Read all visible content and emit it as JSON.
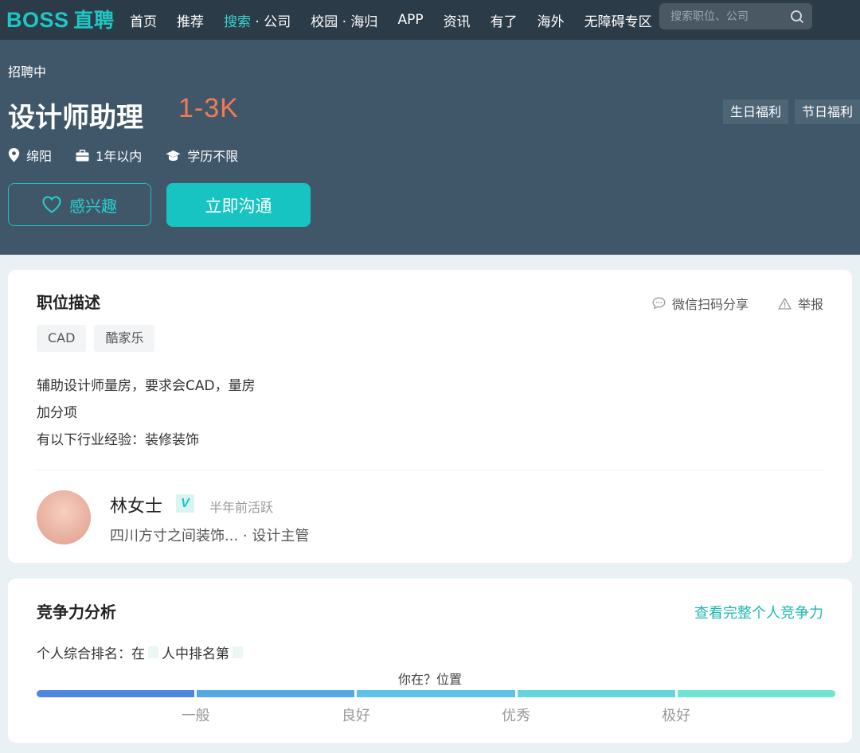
{
  "nav": {
    "logo_en": "BOSS",
    "logo_zh": "直聘",
    "items": [
      {
        "label": "首页"
      },
      {
        "label": "推荐"
      },
      {
        "label": "搜索",
        "sub": " · 公司"
      },
      {
        "label": "校园 · 海归"
      },
      {
        "label": "APP"
      },
      {
        "label": "资讯"
      },
      {
        "label": "有了"
      },
      {
        "label": "海外"
      },
      {
        "label": "无障碍专区"
      }
    ],
    "search_placeholder": "搜索职位、公司"
  },
  "job": {
    "status": "招聘中",
    "title": "设计师助理",
    "salary": "1-3K",
    "benefits": [
      "生日福利",
      "节日福利"
    ],
    "location": "绵阳",
    "experience": "1年以内",
    "education": "学历不限",
    "interest_label": "感兴趣",
    "chat_label": "立即沟通"
  },
  "description": {
    "title": "职位描述",
    "share_label": "微信扫码分享",
    "report_label": "举报",
    "skills": [
      "CAD",
      "酷家乐"
    ],
    "lines": [
      "辅助设计师量房，要求会CAD，量房",
      "加分项",
      "有以下行业经验：装修装饰"
    ]
  },
  "recruiter": {
    "name": "林女士",
    "verified_mark": "V",
    "active": "半年前活跃",
    "company_role": "四川方寸之间装饰...  ·  设计主管"
  },
  "competition": {
    "title": "竞争力分析",
    "link": "查看完整个人竞争力",
    "rank_prefix": "个人综合排名：在",
    "rank_mid": "人中排名第",
    "position_label": "你在？位置",
    "levels": [
      "一般",
      "良好",
      "优秀",
      "极好"
    ],
    "bar_colors": [
      "#4f86e0",
      "#55a7e6",
      "#5cc2e8",
      "#62d6dc",
      "#6ee6cf"
    ]
  }
}
